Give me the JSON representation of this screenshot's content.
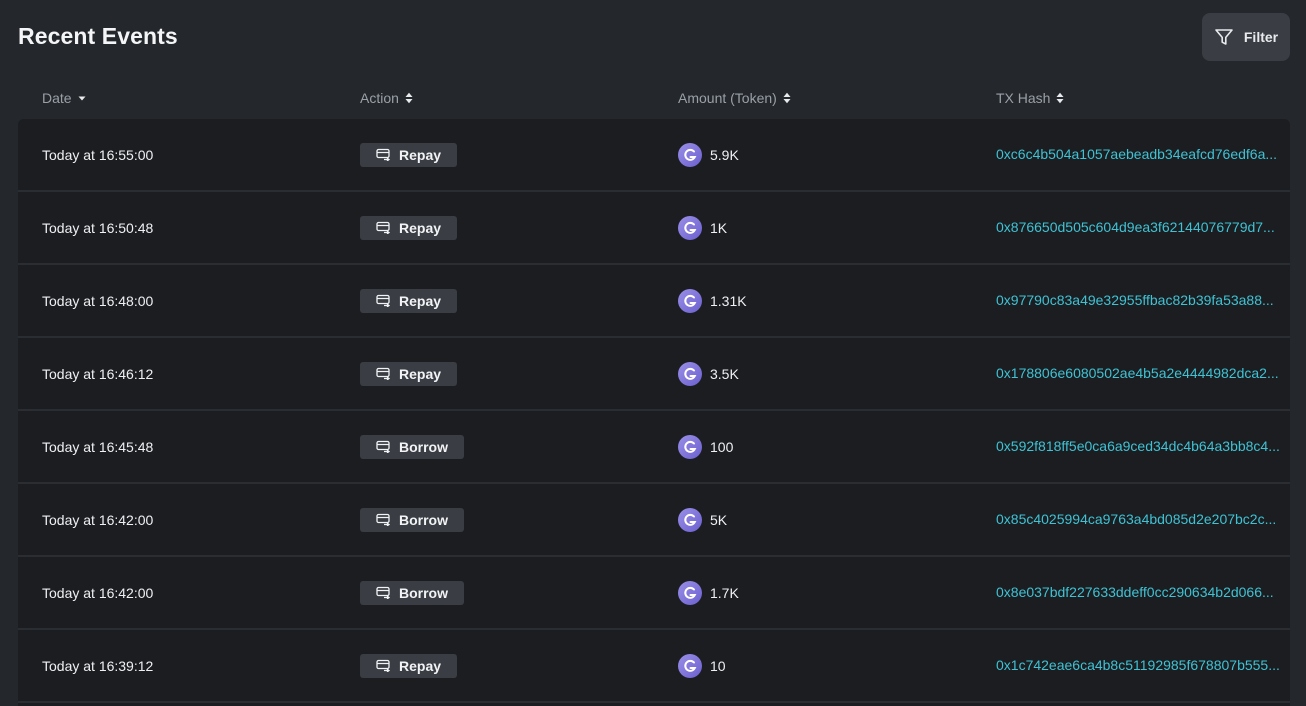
{
  "header": {
    "title": "Recent Events",
    "filter_label": "Filter"
  },
  "columns": {
    "date": "Date",
    "action": "Action",
    "amount": "Amount (Token)",
    "tx_hash": "TX Hash"
  },
  "rows": [
    {
      "date": "Today at 16:55:00",
      "action": "Repay",
      "amount": "5.9K",
      "tx_hash": "0xc6c4b504a1057aebeadb34eafcd76edf6a..."
    },
    {
      "date": "Today at 16:50:48",
      "action": "Repay",
      "amount": "1K",
      "tx_hash": "0x876650d505c604d9ea3f62144076779d7..."
    },
    {
      "date": "Today at 16:48:00",
      "action": "Repay",
      "amount": "1.31K",
      "tx_hash": "0x97790c83a49e32955ffbac82b39fa53a88..."
    },
    {
      "date": "Today at 16:46:12",
      "action": "Repay",
      "amount": "3.5K",
      "tx_hash": "0x178806e6080502ae4b5a2e4444982dca2..."
    },
    {
      "date": "Today at 16:45:48",
      "action": "Borrow",
      "amount": "100",
      "tx_hash": "0x592f818ff5e0ca6a9ced34dc4b64a3bb8c4..."
    },
    {
      "date": "Today at 16:42:00",
      "action": "Borrow",
      "amount": "5K",
      "tx_hash": "0x85c4025994ca9763a4bd085d2e207bc2c..."
    },
    {
      "date": "Today at 16:42:00",
      "action": "Borrow",
      "amount": "1.7K",
      "tx_hash": "0x8e037bdf227633ddeff0cc290634b2d066..."
    },
    {
      "date": "Today at 16:39:12",
      "action": "Repay",
      "amount": "10",
      "tx_hash": "0x1c742eae6ca4b8c51192985f678807b555..."
    }
  ],
  "icons": {
    "filter": "filter-icon",
    "sort_desc": "sort-desc-icon",
    "sort_both": "sort-icon",
    "action": "card-transfer-icon",
    "token": "token-logo-icon"
  },
  "colors": {
    "background": "#24272b",
    "table": "#1b1d20",
    "badge": "#3a3e44",
    "link": "#3fc2d4"
  }
}
